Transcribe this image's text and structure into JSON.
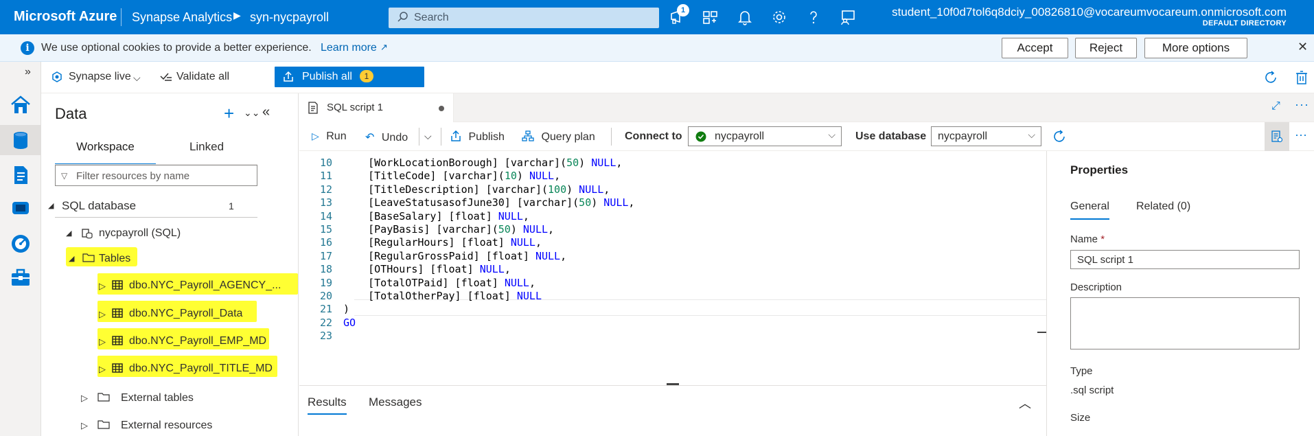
{
  "topbar": {
    "brand": "Microsoft Azure",
    "service": "Synapse Analytics",
    "workspace": "syn-nycpayroll",
    "search_placeholder": "Search",
    "notification_count": "1",
    "user": "student_10f0d7tol6q8dciy_00826810@vocareumvocareum.onmicrosoft.com",
    "directory": "DEFAULT DIRECTORY",
    "icons": [
      "feedback-icon",
      "portal-settings-icon",
      "bell-icon",
      "gear-icon",
      "help-icon",
      "person-feedback-icon"
    ]
  },
  "cookie_banner": {
    "message": "We use optional cookies to provide a better experience.",
    "learn_more": "Learn more",
    "accept": "Accept",
    "reject": "Reject",
    "more_options": "More options"
  },
  "toolbar": {
    "live_mode": "Synapse live",
    "validate_all": "Validate all",
    "publish_all": "Publish all",
    "publish_count": "1"
  },
  "data_panel": {
    "title": "Data",
    "tabs": [
      "Workspace",
      "Linked"
    ],
    "active_tab": "Workspace",
    "filter_placeholder": "Filter resources by name",
    "sql_database_label": "SQL database",
    "sql_database_count": "1",
    "database": "nycpayroll (SQL)",
    "tables_label": "Tables",
    "tables": [
      "dbo.NYC_Payroll_AGENCY_...",
      "dbo.NYC_Payroll_Data",
      "dbo.NYC_Payroll_EMP_MD",
      "dbo.NYC_Payroll_TITLE_MD"
    ],
    "external_tables": "External tables",
    "external_resources": "External resources"
  },
  "editor": {
    "tab_title": "SQL script 1",
    "run": "Run",
    "undo": "Undo",
    "publish": "Publish",
    "query_plan": "Query plan",
    "connect_to_label": "Connect to",
    "connect_to_value": "nycpayroll",
    "use_database_label": "Use database",
    "use_database_value": "nycpayroll",
    "lines": [
      {
        "n": "10",
        "text": "    [WorkLocationBorough] [varchar](50) NULL,"
      },
      {
        "n": "11",
        "text": "    [TitleCode] [varchar](10) NULL,"
      },
      {
        "n": "12",
        "text": "    [TitleDescription] [varchar](100) NULL,"
      },
      {
        "n": "13",
        "text": "    [LeaveStatusasofJune30] [varchar](50) NULL,"
      },
      {
        "n": "14",
        "text": "    [BaseSalary] [float] NULL,"
      },
      {
        "n": "15",
        "text": "    [PayBasis] [varchar](50) NULL,"
      },
      {
        "n": "16",
        "text": "    [RegularHours] [float] NULL,"
      },
      {
        "n": "17",
        "text": "    [RegularGrossPaid] [float] NULL,"
      },
      {
        "n": "18",
        "text": "    [OTHours] [float] NULL,"
      },
      {
        "n": "19",
        "text": "    [TotalOTPaid] [float] NULL,"
      },
      {
        "n": "20",
        "text": "    [TotalOtherPay] [float] NULL"
      },
      {
        "n": "21",
        "text": ")"
      },
      {
        "n": "22",
        "text": "GO"
      },
      {
        "n": "23",
        "text": ""
      }
    ]
  },
  "results": {
    "tabs": [
      "Results",
      "Messages"
    ],
    "active_tab": "Results"
  },
  "properties": {
    "title": "Properties",
    "tabs": [
      "General",
      "Related (0)"
    ],
    "active_tab": "General",
    "name_label": "Name",
    "name_required": "*",
    "name_value": "SQL script 1",
    "description_label": "Description",
    "description_value": "",
    "type_label": "Type",
    "type_value": ".sql script",
    "size_label": "Size"
  },
  "colors": {
    "azure_blue": "#0078d4",
    "highlight": "#ffff33",
    "keyword": "#0000ff",
    "number": "#098658",
    "success": "#107c10"
  }
}
